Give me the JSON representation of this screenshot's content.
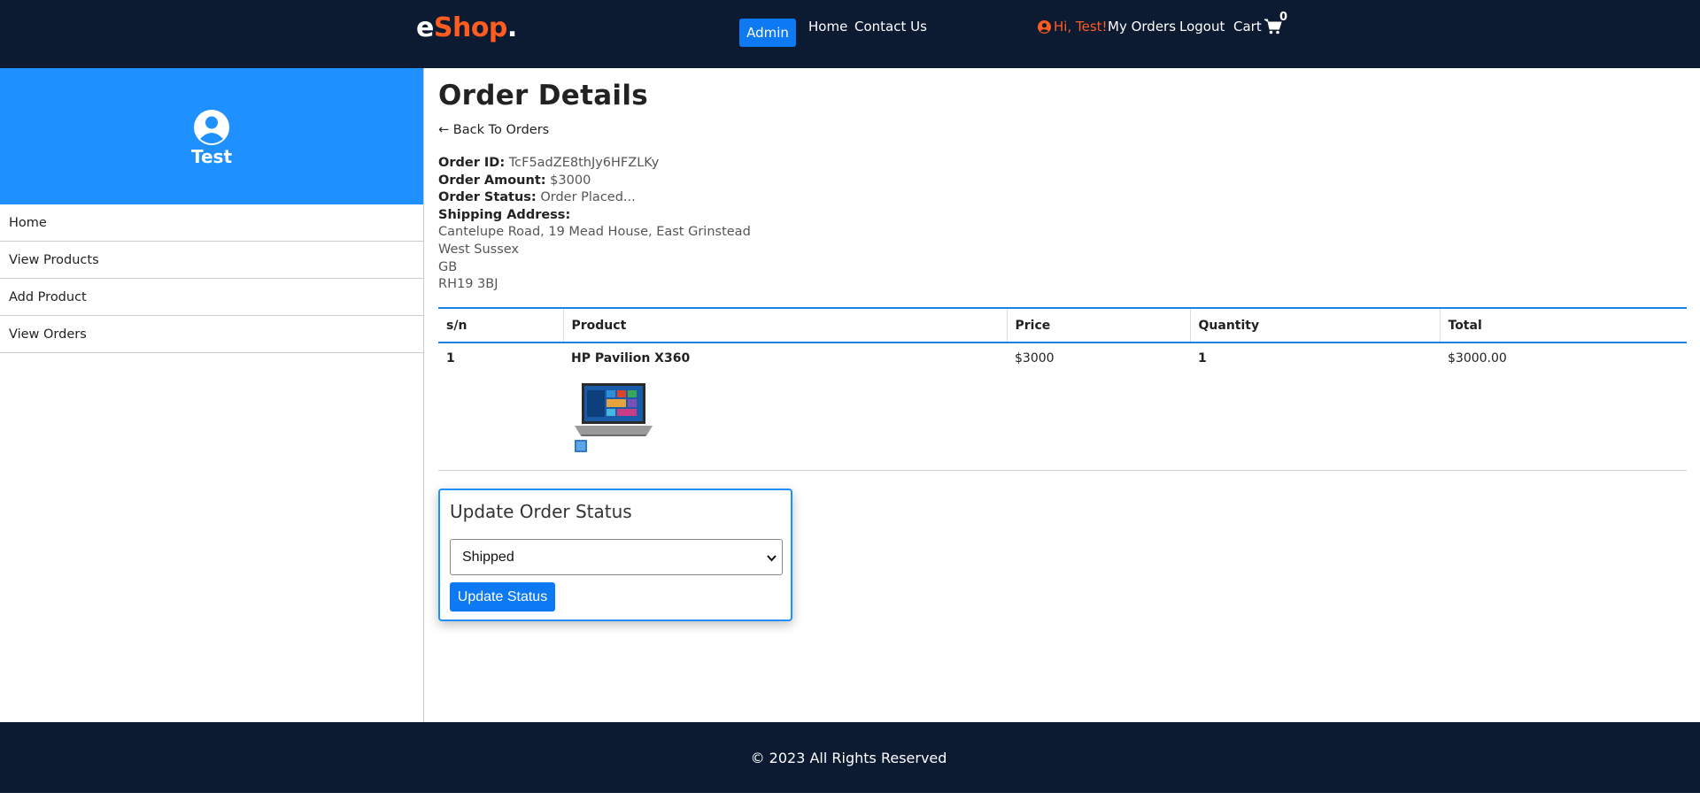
{
  "header": {
    "logo_main": "e",
    "logo_accent": "Shop",
    "logo_dot": ".",
    "admin_label": "Admin",
    "nav": {
      "home": "Home",
      "contact": "Contact Us"
    },
    "greeting": "Hi, Test!",
    "my_orders": "My Orders",
    "logout": "Logout",
    "cart_label": "Cart",
    "cart_count": "0"
  },
  "sidebar": {
    "username": "Test",
    "items": [
      {
        "label": "Home"
      },
      {
        "label": "View Products"
      },
      {
        "label": "Add Product"
      },
      {
        "label": "View Orders"
      }
    ]
  },
  "order": {
    "title": "Order Details",
    "back_link": "← Back To Orders",
    "id_label": "Order ID:",
    "id_value": "TcF5adZE8thJy6HFZLKy",
    "amount_label": "Order Amount:",
    "amount_value": "$3000",
    "status_label": "Order Status:",
    "status_value": "Order Placed...",
    "shipping_label": "Shipping Address:",
    "address_lines": [
      "Cantelupe Road, 19 Mead House, East Grinstead",
      "West Sussex",
      "GB",
      "RH19 3BJ"
    ]
  },
  "table": {
    "headers": [
      "s/n",
      "Product",
      "Price",
      "Quantity",
      "Total"
    ],
    "rows": [
      {
        "sn": "1",
        "product": "HP Pavilion X360",
        "price": "$3000",
        "quantity": "1",
        "total": "$3000.00"
      }
    ]
  },
  "update_status": {
    "title": "Update Order Status",
    "selected": "Shipped",
    "button": "Update Status"
  },
  "footer": {
    "text": "© 2023 All Rights Reserved"
  },
  "colors": {
    "navbar": "#0c1a32",
    "accent": "#ff5c1f",
    "primary": "#1e90ff",
    "button": "#0d79f2"
  },
  "icons": [
    "user-circle-icon",
    "shopping-cart-icon",
    "chevron-down-icon",
    "laptop-product-image"
  ]
}
